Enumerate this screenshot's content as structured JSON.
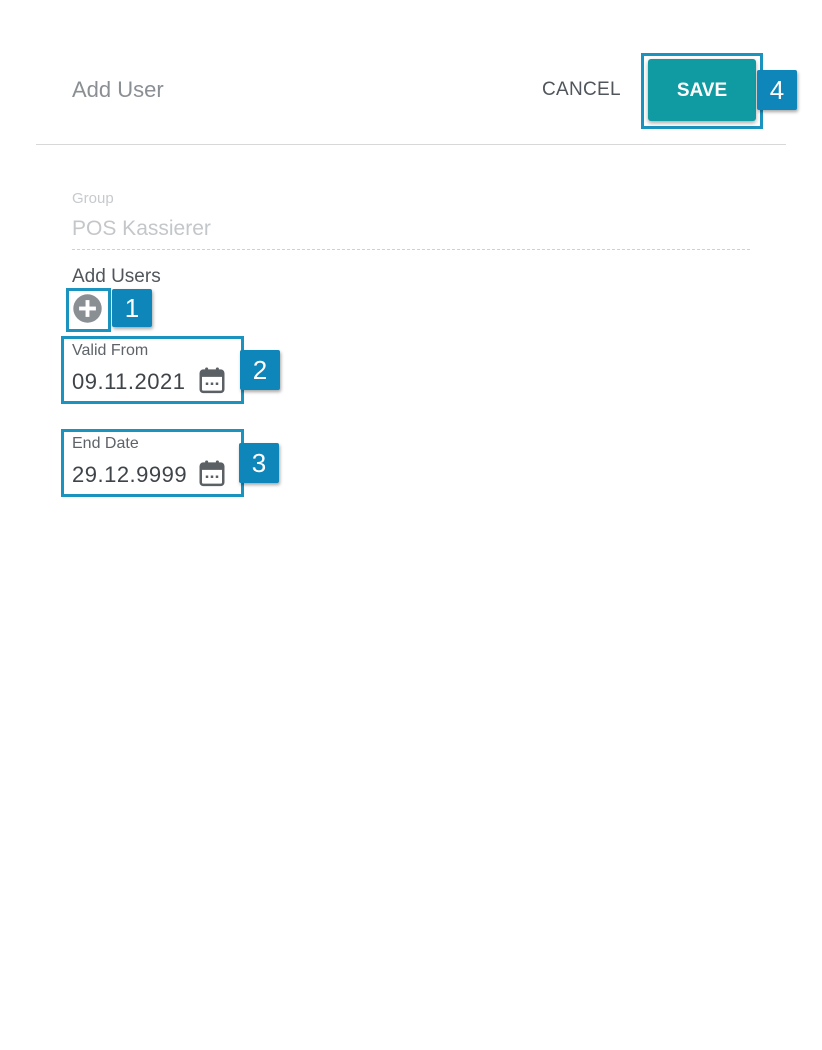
{
  "header": {
    "title": "Add User",
    "cancel_label": "CANCEL",
    "save_label": "SAVE"
  },
  "form": {
    "group_label": "Group",
    "group_value": "POS Kassierer",
    "add_users_label": "Add Users",
    "valid_from": {
      "label": "Valid From",
      "value": "09.11.2021"
    },
    "end_date": {
      "label": "End Date",
      "value": "29.12.9999"
    }
  },
  "badges": [
    "1",
    "2",
    "3",
    "4"
  ],
  "colors": {
    "accent": "#0f9ba1",
    "highlight": "#1a93be",
    "badge": "#0f86b9"
  },
  "icons": {
    "add": "plus-circle-icon",
    "calendar": "calendar-icon"
  }
}
